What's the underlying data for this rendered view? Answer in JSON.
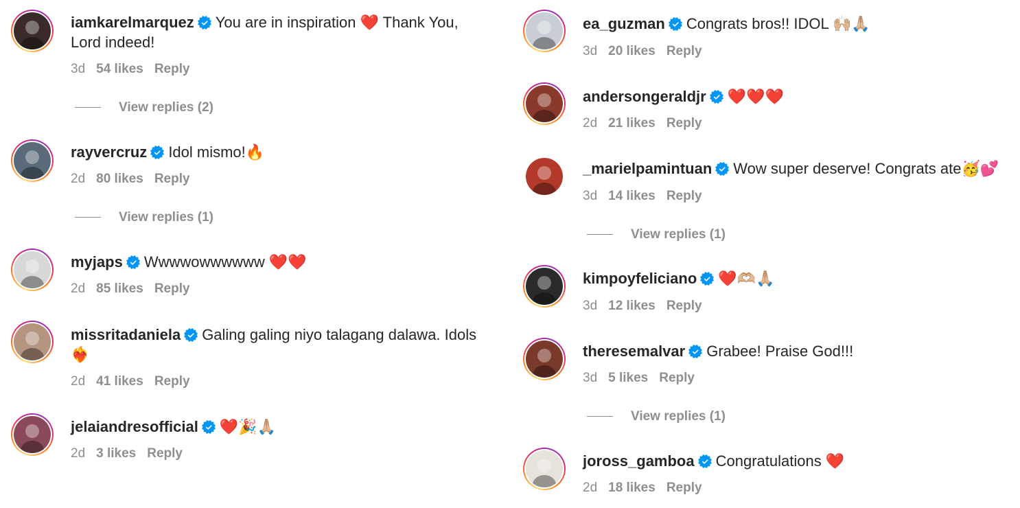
{
  "left_column": [
    {
      "username": "iamkarelmarquez",
      "text": "You are in inspiration ❤️ Thank You, Lord indeed!",
      "time": "3d",
      "likes": "54 likes",
      "reply": "Reply",
      "view_replies": "View replies (2)",
      "avatar_color": "#3a2a2a"
    },
    {
      "username": "rayvercruz",
      "text": "Idol mismo!🔥",
      "time": "2d",
      "likes": "80 likes",
      "reply": "Reply",
      "view_replies": "View replies (1)",
      "avatar_color": "#5a6a7a"
    },
    {
      "username": "myjaps",
      "text": "Wwwwowwwwww ❤️❤️",
      "time": "2d",
      "likes": "85 likes",
      "reply": "Reply",
      "avatar_color": "#d8d8d8"
    },
    {
      "username": "missritadaniela",
      "text": "Galing galing niyo talagang dalawa. Idols ❤️‍🔥",
      "time": "2d",
      "likes": "41 likes",
      "reply": "Reply",
      "avatar_color": "#b59480"
    },
    {
      "username": "jelaiandresofficial",
      "text": "❤️🎉🙏🏼",
      "time": "2d",
      "likes": "3 likes",
      "reply": "Reply",
      "avatar_color": "#8a4a5a"
    }
  ],
  "right_column": [
    {
      "username": "ea_guzman",
      "text": "Congrats bros!! IDOL 🙌🏼🙏🏼",
      "time": "3d",
      "likes": "20 likes",
      "reply": "Reply",
      "avatar_color": "#c9ced6"
    },
    {
      "username": "andersongeraldjr",
      "text": "❤️❤️❤️",
      "time": "2d",
      "likes": "21 likes",
      "reply": "Reply",
      "avatar_color": "#8a3a2a"
    },
    {
      "username": "_marielpamintuan",
      "text": "Wow super deserve! Congrats ate🥳💕",
      "time": "3d",
      "likes": "14 likes",
      "reply": "Reply",
      "view_replies": "View replies (1)",
      "avatar_color": "#b33a2a"
    },
    {
      "username": "kimpoyfeliciano",
      "text": "❤️🫶🏼🙏🏼",
      "time": "3d",
      "likes": "12 likes",
      "reply": "Reply",
      "avatar_color": "#2a2a2a"
    },
    {
      "username": "theresemalvar",
      "text": "Grabee! Praise God!!!",
      "time": "3d",
      "likes": "5 likes",
      "reply": "Reply",
      "view_replies": "View replies (1)",
      "avatar_color": "#7a3a2a"
    },
    {
      "username": "joross_gamboa",
      "text": "Congratulations ❤️",
      "time": "2d",
      "likes": "18 likes",
      "reply": "Reply",
      "avatar_color": "#e6e2dc"
    }
  ],
  "colors": {
    "text": "#262626",
    "muted": "#8e8e8e",
    "verified": "#0095f6"
  }
}
